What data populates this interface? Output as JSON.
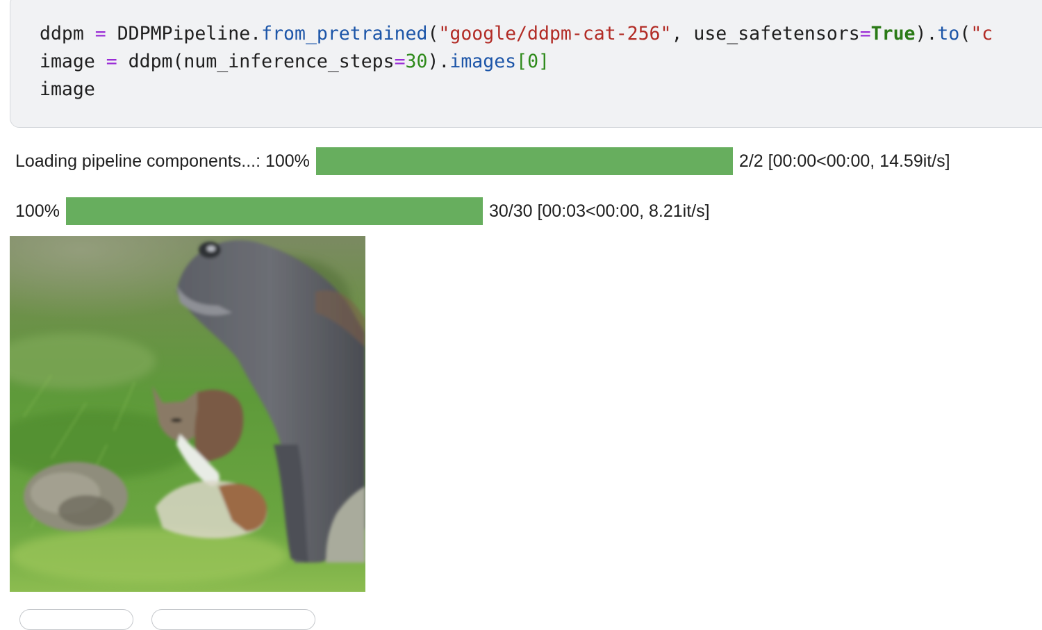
{
  "code_cell": {
    "lines": [
      [
        {
          "t": "ddpm ",
          "c": "txt"
        },
        {
          "t": "=",
          "c": "op"
        },
        {
          "t": " DDPMPipeline.",
          "c": "txt"
        },
        {
          "t": "from_pretrained",
          "c": "attr"
        },
        {
          "t": "(",
          "c": "txt"
        },
        {
          "t": "\"google/ddpm-cat-256\"",
          "c": "str"
        },
        {
          "t": ", use_safetensors",
          "c": "txt"
        },
        {
          "t": "=",
          "c": "op"
        },
        {
          "t": "True",
          "c": "kw"
        },
        {
          "t": ").",
          "c": "txt"
        },
        {
          "t": "to",
          "c": "attr"
        },
        {
          "t": "(",
          "c": "txt"
        },
        {
          "t": "\"c",
          "c": "str"
        }
      ],
      [
        {
          "t": "image ",
          "c": "txt"
        },
        {
          "t": "=",
          "c": "op"
        },
        {
          "t": " ddpm(num_inference_steps",
          "c": "txt"
        },
        {
          "t": "=",
          "c": "op"
        },
        {
          "t": "30",
          "c": "num"
        },
        {
          "t": ").",
          "c": "txt"
        },
        {
          "t": "images",
          "c": "attr"
        },
        {
          "t": "[",
          "c": "brk"
        },
        {
          "t": "0",
          "c": "num"
        },
        {
          "t": "]",
          "c": "brk"
        }
      ],
      [
        {
          "t": "image",
          "c": "txt"
        }
      ]
    ]
  },
  "progress": [
    {
      "label": "Loading pipeline components...: 100%",
      "fraction": 1.0,
      "stats": "2/2 [00:00<00:00, 14.59it/s]"
    },
    {
      "label": "100%",
      "fraction": 1.0,
      "stats": "30/30 [00:03<00:00, 8.21it/s]"
    }
  ],
  "colors": {
    "progress_fill": "#67ae5e",
    "code_bg": "#f1f2f4",
    "keyword_op": "#9a2cd6",
    "attribute": "#1c55a8",
    "string": "#b22b25",
    "bool": "#2a7a16",
    "number": "#2e8a1a"
  },
  "output": {
    "image_kind": "generated-cat-photo"
  }
}
